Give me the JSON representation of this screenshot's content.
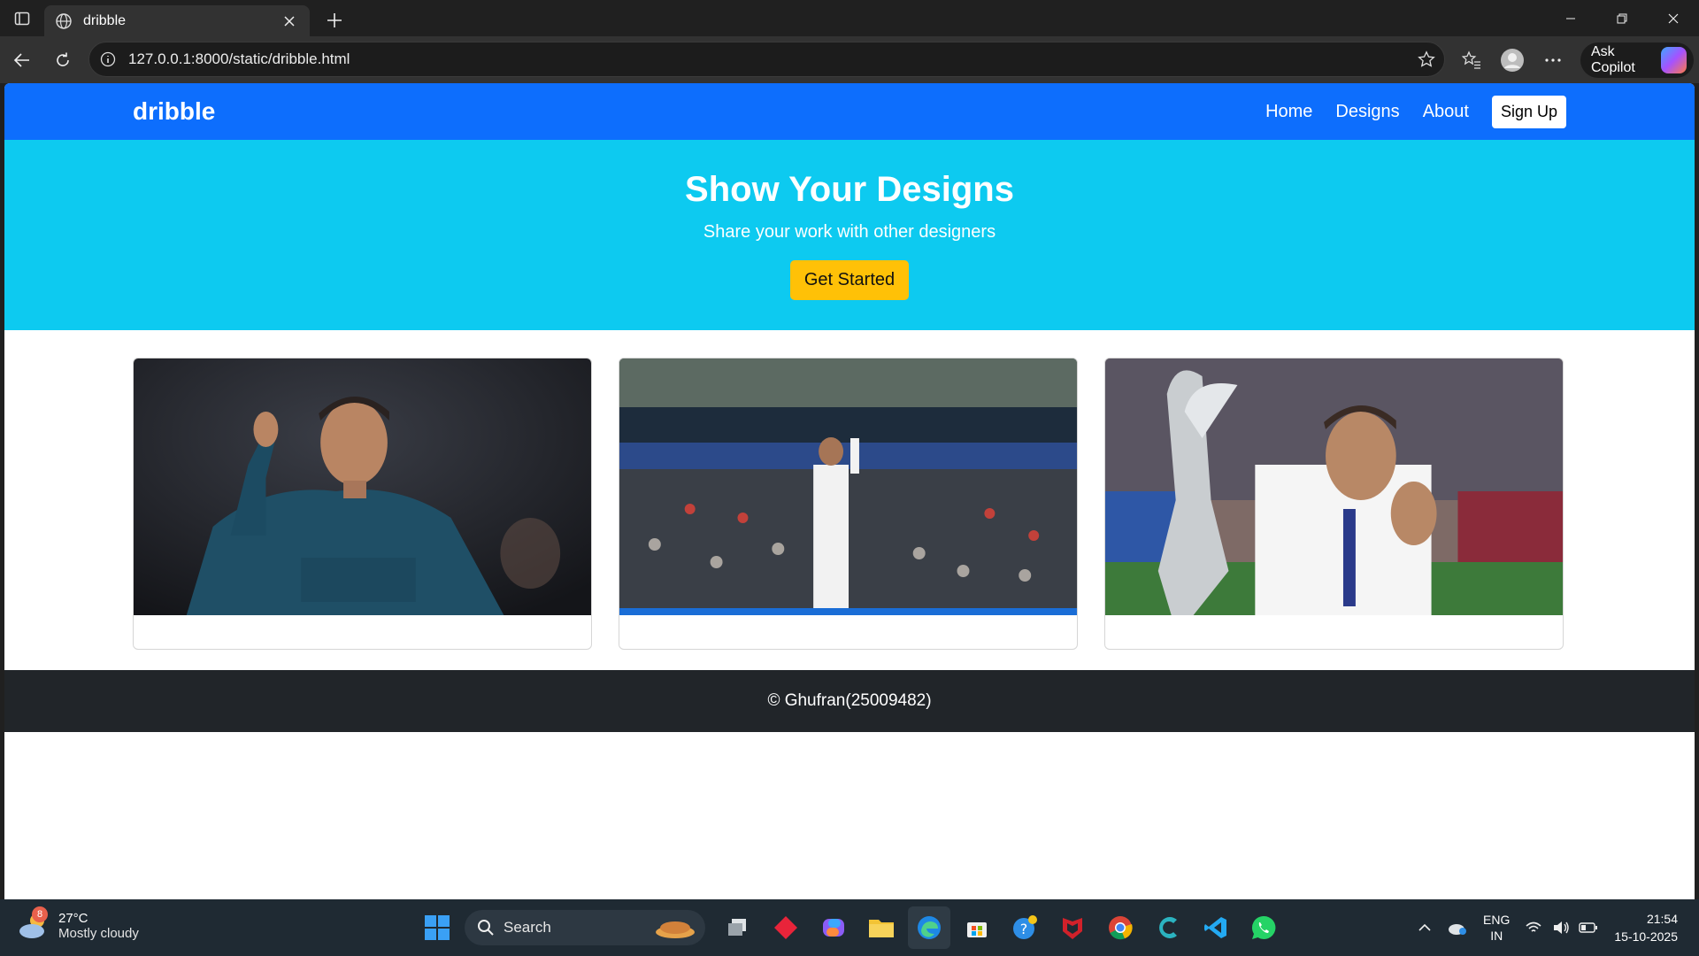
{
  "browser": {
    "tab_title": "dribble",
    "url": "127.0.0.1:8000/static/dribble.html",
    "copilot_label": "Ask Copilot"
  },
  "page": {
    "brand": "dribble",
    "nav": [
      "Home",
      "Designs",
      "About"
    ],
    "signup_label": "Sign Up",
    "hero_title": "Show Your Designs",
    "hero_subtitle": "Share your work with other designers",
    "hero_button": "Get Started",
    "footer_text": "© Ghufran(25009482)",
    "colors": {
      "navbar": "#0d6efd",
      "hero": "#0dcaf0",
      "cta": "#ffc107",
      "footer": "#212529"
    }
  },
  "taskbar": {
    "weather_temp": "27°C",
    "weather_cond": "Mostly cloudy",
    "weather_badge": "8",
    "search_label": "Search",
    "lang_line1": "ENG",
    "lang_line2": "IN",
    "time": "21:54",
    "date": "15-10-2025",
    "apps": [
      "windows-start-icon",
      "task-view-icon",
      "red-app-icon",
      "copilot-app-icon",
      "file-explorer-icon",
      "edge-icon",
      "store-icon",
      "help-icon",
      "mcafee-icon",
      "chrome-icon",
      "cortana-app-icon",
      "vscode-icon",
      "whatsapp-icon"
    ]
  }
}
